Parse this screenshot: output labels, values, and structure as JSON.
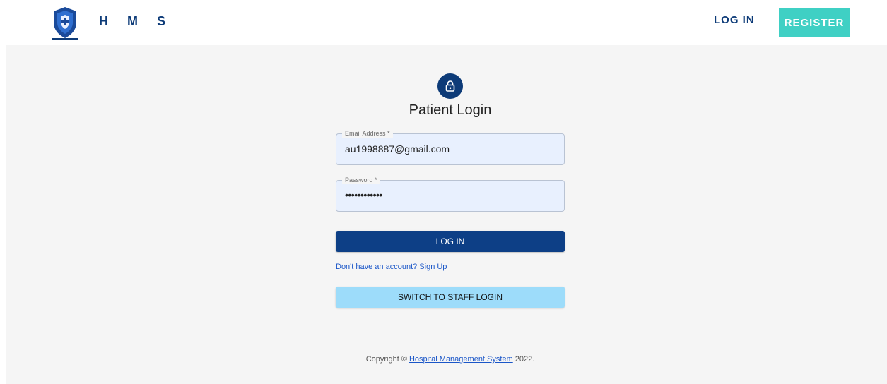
{
  "header": {
    "brand": "H M S",
    "login_label": "LOG IN",
    "register_label": "REGISTER"
  },
  "login_form": {
    "title": "Patient Login",
    "email": {
      "label": "Email Address *",
      "value": "au1998887@gmail.com"
    },
    "password": {
      "label": "Password *",
      "value": "••••••••••••"
    },
    "submit_label": "LOG IN",
    "signup_link": "Don't have an account? Sign Up",
    "switch_label": "SWITCH TO STAFF LOGIN"
  },
  "footer": {
    "prefix": "Copyright © ",
    "link": "Hospital Management System",
    "suffix": " 2022."
  },
  "colors": {
    "brand_navy": "#0d3b78",
    "register_teal": "#3fd0c4",
    "staff_button": "#9ddcfa",
    "link_blue": "#1a56c8"
  },
  "icons": {
    "logo": "shield-medical-cross-icon",
    "avatar": "lock-icon"
  }
}
